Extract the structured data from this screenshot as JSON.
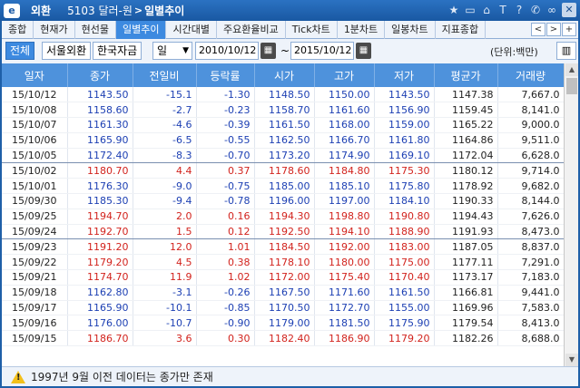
{
  "title": {
    "logo_text": "e",
    "app": "외환",
    "code": "5103 달러-원",
    "sep": ">",
    "screen": "일별추이"
  },
  "title_icons": [
    "star-icon",
    "window-icon",
    "lock-icon",
    "text-icon",
    "help-icon",
    "phone-icon",
    "link-icon",
    "close-icon"
  ],
  "tabs": [
    {
      "label": "종합",
      "active": false
    },
    {
      "label": "현재가",
      "active": false
    },
    {
      "label": "현선물",
      "active": false
    },
    {
      "label": "일별추이",
      "active": true
    },
    {
      "label": "시간대별",
      "active": false
    },
    {
      "label": "주요환율비교",
      "active": false
    },
    {
      "label": "Tick차트",
      "active": false
    },
    {
      "label": "1분차트",
      "active": false
    },
    {
      "label": "일봉차트",
      "active": false
    },
    {
      "label": "지표종합",
      "active": false
    }
  ],
  "tab_nav": {
    "prev": "<",
    "next": ">",
    "add": "+"
  },
  "controls": {
    "segments": [
      {
        "label": "전체",
        "active": true
      },
      {
        "label": "서울외환",
        "active": false
      },
      {
        "label": "한국자금",
        "active": false
      }
    ],
    "period": "일",
    "start_date": "2010/10/12",
    "tilde": "~",
    "end_date": "2015/10/12",
    "unit": "(단위:백만)"
  },
  "table": {
    "columns": [
      "일자",
      "종가",
      "전일비",
      "등락률",
      "시가",
      "고가",
      "저가",
      "평균가",
      "거래량"
    ],
    "rows": [
      {
        "date": "15/10/12",
        "close": "1143.50",
        "change": "-15.1",
        "rate": "-1.30",
        "open": "1148.50",
        "high": "1150.00",
        "low": "1143.50",
        "avg": "1147.38",
        "vol": "7,667.0",
        "dir": "dn"
      },
      {
        "date": "15/10/08",
        "close": "1158.60",
        "change": "-2.7",
        "rate": "-0.23",
        "open": "1158.70",
        "high": "1161.60",
        "low": "1156.90",
        "avg": "1159.45",
        "vol": "8,141.0",
        "dir": "dn"
      },
      {
        "date": "15/10/07",
        "close": "1161.30",
        "change": "-4.6",
        "rate": "-0.39",
        "open": "1161.50",
        "high": "1168.00",
        "low": "1159.00",
        "avg": "1165.22",
        "vol": "9,000.0",
        "dir": "dn"
      },
      {
        "date": "15/10/06",
        "close": "1165.90",
        "change": "-6.5",
        "rate": "-0.55",
        "open": "1162.50",
        "high": "1166.70",
        "low": "1161.80",
        "avg": "1164.86",
        "vol": "9,511.0",
        "dir": "dn"
      },
      {
        "date": "15/10/05",
        "close": "1172.40",
        "change": "-8.3",
        "rate": "-0.70",
        "open": "1173.20",
        "high": "1174.90",
        "low": "1169.10",
        "avg": "1172.04",
        "vol": "6,628.0",
        "dir": "dn"
      },
      {
        "date": "15/10/02",
        "close": "1180.70",
        "change": "4.4",
        "rate": "0.37",
        "open": "1178.60",
        "high": "1184.80",
        "low": "1175.30",
        "avg": "1180.12",
        "vol": "9,714.0",
        "dir": "up"
      },
      {
        "date": "15/10/01",
        "close": "1176.30",
        "change": "-9.0",
        "rate": "-0.75",
        "open": "1185.00",
        "high": "1185.10",
        "low": "1175.80",
        "avg": "1178.92",
        "vol": "9,682.0",
        "dir": "dn"
      },
      {
        "date": "15/09/30",
        "close": "1185.30",
        "change": "-9.4",
        "rate": "-0.78",
        "open": "1196.00",
        "high": "1197.00",
        "low": "1184.10",
        "avg": "1190.33",
        "vol": "8,144.0",
        "dir": "dn"
      },
      {
        "date": "15/09/25",
        "close": "1194.70",
        "change": "2.0",
        "rate": "0.16",
        "open": "1194.30",
        "high": "1198.80",
        "low": "1190.80",
        "avg": "1194.43",
        "vol": "7,626.0",
        "dir": "up"
      },
      {
        "date": "15/09/24",
        "close": "1192.70",
        "change": "1.5",
        "rate": "0.12",
        "open": "1192.50",
        "high": "1194.10",
        "low": "1188.90",
        "avg": "1191.93",
        "vol": "8,473.0",
        "dir": "up"
      },
      {
        "date": "15/09/23",
        "close": "1191.20",
        "change": "12.0",
        "rate": "1.01",
        "open": "1184.50",
        "high": "1192.00",
        "low": "1183.00",
        "avg": "1187.05",
        "vol": "8,837.0",
        "dir": "up"
      },
      {
        "date": "15/09/22",
        "close": "1179.20",
        "change": "4.5",
        "rate": "0.38",
        "open": "1178.10",
        "high": "1180.00",
        "low": "1175.00",
        "avg": "1177.11",
        "vol": "7,291.0",
        "dir": "up"
      },
      {
        "date": "15/09/21",
        "close": "1174.70",
        "change": "11.9",
        "rate": "1.02",
        "open": "1172.00",
        "high": "1175.40",
        "low": "1170.40",
        "avg": "1173.17",
        "vol": "7,183.0",
        "dir": "up"
      },
      {
        "date": "15/09/18",
        "close": "1162.80",
        "change": "-3.1",
        "rate": "-0.26",
        "open": "1167.50",
        "high": "1171.60",
        "low": "1161.50",
        "avg": "1166.81",
        "vol": "9,441.0",
        "dir": "dn"
      },
      {
        "date": "15/09/17",
        "close": "1165.90",
        "change": "-10.1",
        "rate": "-0.85",
        "open": "1170.50",
        "high": "1172.70",
        "low": "1155.00",
        "avg": "1169.96",
        "vol": "7,583.0",
        "dir": "dn"
      },
      {
        "date": "15/09/16",
        "close": "1176.00",
        "change": "-10.7",
        "rate": "-0.90",
        "open": "1179.00",
        "high": "1181.50",
        "low": "1175.90",
        "avg": "1179.54",
        "vol": "8,413.0",
        "dir": "dn"
      },
      {
        "date": "15/09/15",
        "close": "1186.70",
        "change": "3.6",
        "rate": "0.30",
        "open": "1182.40",
        "high": "1186.90",
        "low": "1179.20",
        "avg": "1182.26",
        "vol": "8,688.0",
        "dir": "up"
      }
    ]
  },
  "status": {
    "icon": "warning-icon",
    "text": "1997년 9월 이전 데이터는 종가만 존재"
  }
}
